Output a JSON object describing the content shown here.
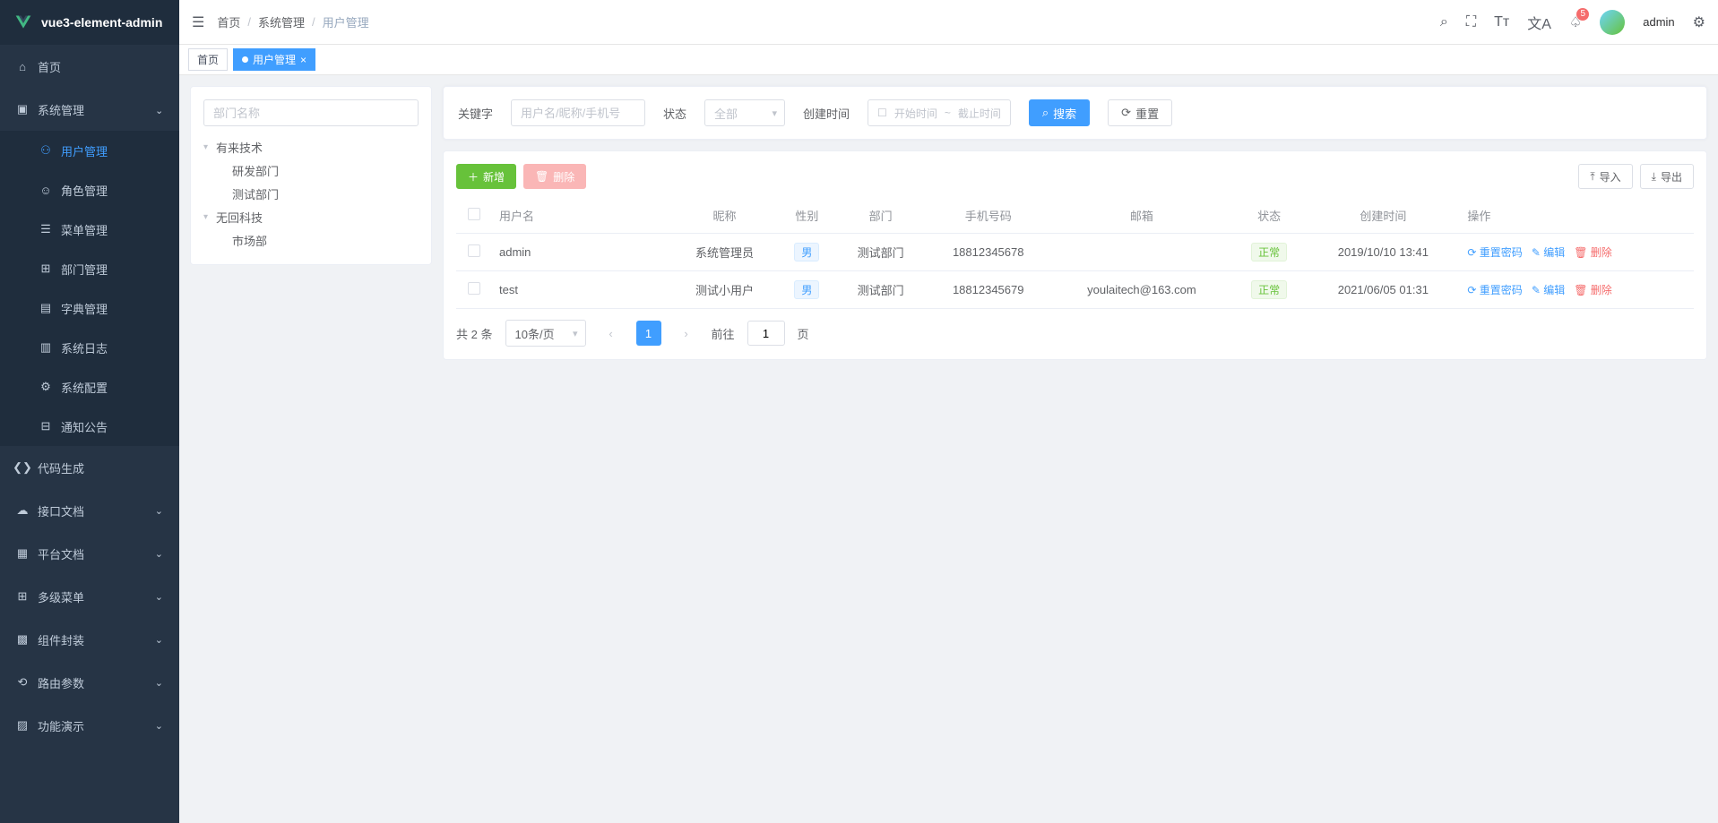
{
  "app": {
    "name": "vue3-element-admin"
  },
  "sidebar": {
    "home": "首页",
    "groups": [
      {
        "label": "系统管理",
        "expanded": true,
        "children": [
          {
            "label": "用户管理",
            "active": true
          },
          {
            "label": "角色管理"
          },
          {
            "label": "菜单管理"
          },
          {
            "label": "部门管理"
          },
          {
            "label": "字典管理"
          },
          {
            "label": "系统日志"
          },
          {
            "label": "系统配置"
          },
          {
            "label": "通知公告"
          }
        ]
      },
      {
        "label": "代码生成",
        "expandable": false
      },
      {
        "label": "接口文档",
        "expandable": true
      },
      {
        "label": "平台文档",
        "expandable": true
      },
      {
        "label": "多级菜单",
        "expandable": true
      },
      {
        "label": "组件封装",
        "expandable": true
      },
      {
        "label": "路由参数",
        "expandable": true
      },
      {
        "label": "功能演示",
        "expandable": true
      }
    ]
  },
  "breadcrumb": [
    "首页",
    "系统管理",
    "用户管理"
  ],
  "header": {
    "username": "admin",
    "badge": "5"
  },
  "tags": [
    {
      "label": "首页",
      "active": false,
      "closable": false
    },
    {
      "label": "用户管理",
      "active": true,
      "closable": true
    }
  ],
  "deptPanel": {
    "placeholder": "部门名称",
    "tree": [
      {
        "label": "有来技术",
        "children": [
          {
            "label": "研发部门"
          },
          {
            "label": "测试部门"
          }
        ]
      },
      {
        "label": "无回科技",
        "children": [
          {
            "label": "市场部"
          }
        ]
      }
    ]
  },
  "filters": {
    "keyword_label": "关键字",
    "keyword_placeholder": "用户名/昵称/手机号",
    "status_label": "状态",
    "status_value": "全部",
    "created_label": "创建时间",
    "date_start_placeholder": "开始时间",
    "date_end_placeholder": "截止时间",
    "search_btn": "搜索",
    "reset_btn": "重置"
  },
  "toolbar": {
    "add": "新增",
    "delete": "删除",
    "import": "导入",
    "export": "导出"
  },
  "table": {
    "headers": [
      "用户名",
      "昵称",
      "性别",
      "部门",
      "手机号码",
      "邮箱",
      "状态",
      "创建时间",
      "操作"
    ],
    "rows": [
      {
        "username": "admin",
        "nickname": "系统管理员",
        "gender": "男",
        "dept": "测试部门",
        "phone": "18812345678",
        "email": "",
        "status": "正常",
        "created": "2019/10/10 13:41"
      },
      {
        "username": "test",
        "nickname": "测试小用户",
        "gender": "男",
        "dept": "测试部门",
        "phone": "18812345679",
        "email": "youlaitech@163.com",
        "status": "正常",
        "created": "2021/06/05 01:31"
      }
    ],
    "ops": {
      "reset_pwd": "重置密码",
      "edit": "编辑",
      "delete": "删除"
    }
  },
  "pagination": {
    "total_prefix": "共",
    "total_count": "2",
    "total_suffix": "条",
    "page_size": "10条/页",
    "current": "1",
    "goto_label": "前往",
    "goto_value": "1",
    "page_unit": "页"
  }
}
